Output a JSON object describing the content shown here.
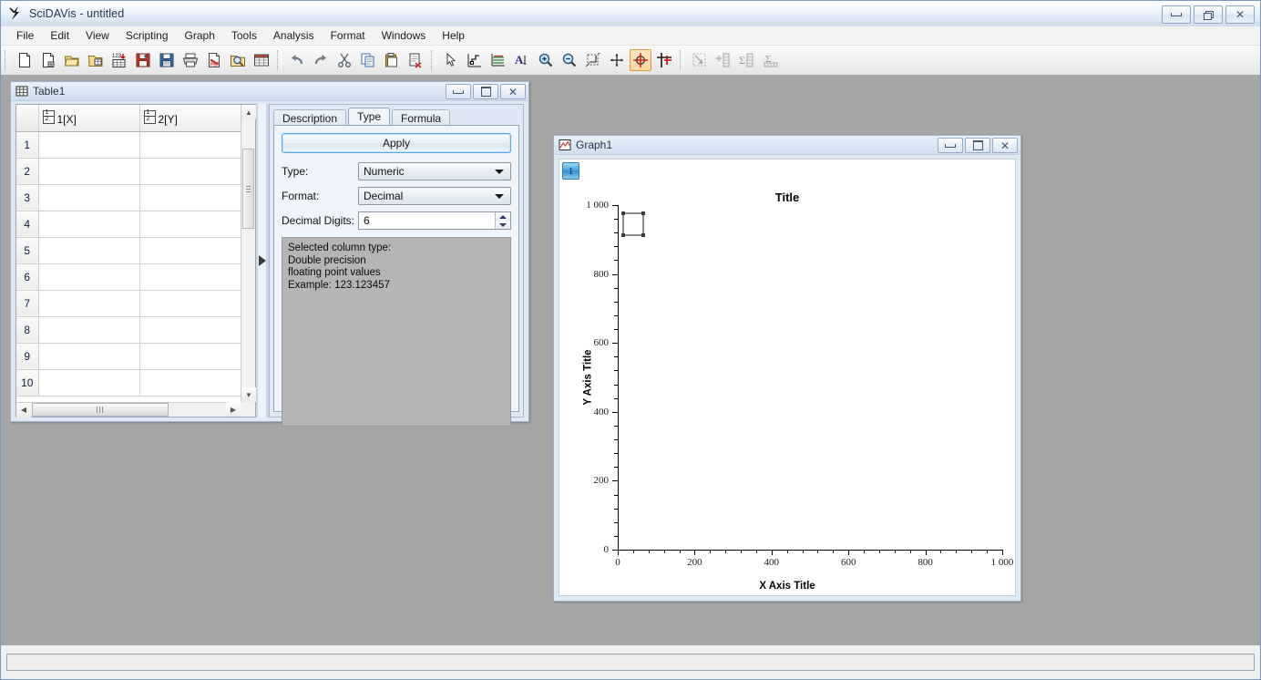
{
  "window": {
    "title": "SciDAVis - untitled",
    "app_icon": "scidavis-logo-icon",
    "controls": {
      "minimize": "minimize-icon",
      "restore": "restore-icon",
      "close": "close-icon"
    }
  },
  "menubar": {
    "items": [
      {
        "label": "File"
      },
      {
        "label": "Edit"
      },
      {
        "label": "View"
      },
      {
        "label": "Scripting"
      },
      {
        "label": "Graph"
      },
      {
        "label": "Tools"
      },
      {
        "label": "Analysis"
      },
      {
        "label": "Format"
      },
      {
        "label": "Windows"
      },
      {
        "label": "Help"
      }
    ]
  },
  "toolbar": {
    "groups": [
      {
        "name": "file-group",
        "buttons": [
          {
            "icon": "new-document-icon",
            "enabled": true
          },
          {
            "icon": "new-table-icon",
            "enabled": true
          },
          {
            "icon": "open-folder-icon",
            "enabled": true
          },
          {
            "icon": "open-template-icon",
            "enabled": true
          },
          {
            "icon": "import-ascii-icon",
            "enabled": true
          },
          {
            "icon": "save-project-icon",
            "enabled": true
          },
          {
            "icon": "save-as-template-icon",
            "enabled": true
          },
          {
            "icon": "print-icon",
            "enabled": true
          },
          {
            "icon": "export-pdf-icon",
            "enabled": true
          },
          {
            "icon": "print-preview-icon",
            "enabled": true
          },
          {
            "icon": "project-explorer-icon",
            "enabled": true
          }
        ]
      },
      {
        "name": "edit-group",
        "buttons": [
          {
            "icon": "undo-icon",
            "enabled": true
          },
          {
            "icon": "redo-icon",
            "enabled": true
          },
          {
            "icon": "cut-icon",
            "enabled": true
          },
          {
            "icon": "copy-icon",
            "enabled": true
          },
          {
            "icon": "paste-icon",
            "enabled": true
          },
          {
            "icon": "delete-icon",
            "enabled": true
          }
        ]
      },
      {
        "name": "plot-tools-group",
        "buttons": [
          {
            "icon": "pointer-arrow-icon",
            "enabled": true
          },
          {
            "icon": "data-reader-icon",
            "enabled": true
          },
          {
            "icon": "select-data-range-icon",
            "enabled": true
          },
          {
            "icon": "add-text-icon",
            "enabled": true
          },
          {
            "icon": "zoom-in-icon",
            "enabled": true
          },
          {
            "icon": "zoom-out-icon",
            "enabled": true
          },
          {
            "icon": "rescale-to-fit-icon",
            "enabled": true
          },
          {
            "icon": "draw-arrow-icon",
            "enabled": true
          },
          {
            "icon": "screen-reader-crosshair-icon",
            "enabled": true,
            "checked": true
          },
          {
            "icon": "move-data-points-icon",
            "enabled": true
          }
        ]
      },
      {
        "name": "table-tools-group",
        "buttons": [
          {
            "icon": "select-region-icon",
            "enabled": false
          },
          {
            "icon": "add-column-icon",
            "enabled": false
          },
          {
            "icon": "column-statistics-icon",
            "enabled": false
          },
          {
            "icon": "row-statistics-icon",
            "enabled": false
          }
        ]
      }
    ]
  },
  "table_window": {
    "title": "Table1",
    "icon": "table-grid-icon",
    "controls": {
      "minimize": "minimize-icon",
      "maximize": "maximize-icon",
      "close": "close-icon"
    },
    "columns": [
      {
        "label": "1[X]",
        "icon": "numeric-column-icon"
      },
      {
        "label": "2[Y]",
        "icon": "numeric-column-icon"
      }
    ],
    "rows": [
      {
        "number": "1",
        "cells": [
          "",
          ""
        ]
      },
      {
        "number": "2",
        "cells": [
          "",
          ""
        ]
      },
      {
        "number": "3",
        "cells": [
          "",
          ""
        ]
      },
      {
        "number": "4",
        "cells": [
          "",
          ""
        ]
      },
      {
        "number": "5",
        "cells": [
          "",
          ""
        ]
      },
      {
        "number": "6",
        "cells": [
          "",
          ""
        ]
      },
      {
        "number": "7",
        "cells": [
          "",
          ""
        ]
      },
      {
        "number": "8",
        "cells": [
          "",
          ""
        ]
      },
      {
        "number": "9",
        "cells": [
          "",
          ""
        ]
      },
      {
        "number": "10",
        "cells": [
          "",
          ""
        ]
      }
    ],
    "splitter_icon": "collapse-panel-arrow-icon",
    "properties": {
      "tabs": [
        {
          "label": "Description",
          "active": false
        },
        {
          "label": "Type",
          "active": true
        },
        {
          "label": "Formula",
          "active": false
        }
      ],
      "apply_label": "Apply",
      "fields": [
        {
          "name": "type",
          "label": "Type:",
          "value": "Numeric",
          "control": "combobox"
        },
        {
          "name": "format",
          "label": "Format:",
          "value": "Decimal",
          "control": "combobox"
        },
        {
          "name": "decimal_digits",
          "label": "Decimal Digits:",
          "value": "6",
          "control": "spinbox"
        }
      ],
      "description_lines": [
        "Selected column type:",
        "Double precision",
        "floating point values",
        "Example: 123.123457"
      ]
    }
  },
  "graph_window": {
    "title": "Graph1",
    "icon": "graph-plot-icon",
    "controls": {
      "minimize": "minimize-icon",
      "maximize": "maximize-icon",
      "close": "close-icon"
    },
    "layer_button": "1"
  },
  "chart_data": {
    "type": "scatter",
    "title": "Title",
    "xlabel": "X Axis Title",
    "ylabel": "Y Axis Title",
    "xlim": [
      0,
      1000
    ],
    "ylim": [
      0,
      1000
    ],
    "xticks": [
      0,
      200,
      400,
      600,
      800,
      1000
    ],
    "yticks": [
      0,
      200,
      400,
      600,
      800,
      1000
    ],
    "xticklabels": [
      "0",
      "200",
      "400",
      "600",
      "800",
      "1 000"
    ],
    "yticklabels": [
      "0",
      "200",
      "400",
      "600",
      "800",
      "1 000"
    ],
    "minor_ticks_per_interval": 4,
    "grid": false,
    "series": [],
    "legend": {
      "entries": [],
      "position": "top-left",
      "selected": true
    }
  },
  "statusbar": {
    "message": ""
  },
  "colors": {
    "accent": "#3ea5e0",
    "titlebar": "#dfe9f3",
    "workspace": "#a6a6a6",
    "panel": "#eef4fa",
    "description_bg": "#b5b5b5",
    "checked_tool": "#fbd79c"
  }
}
